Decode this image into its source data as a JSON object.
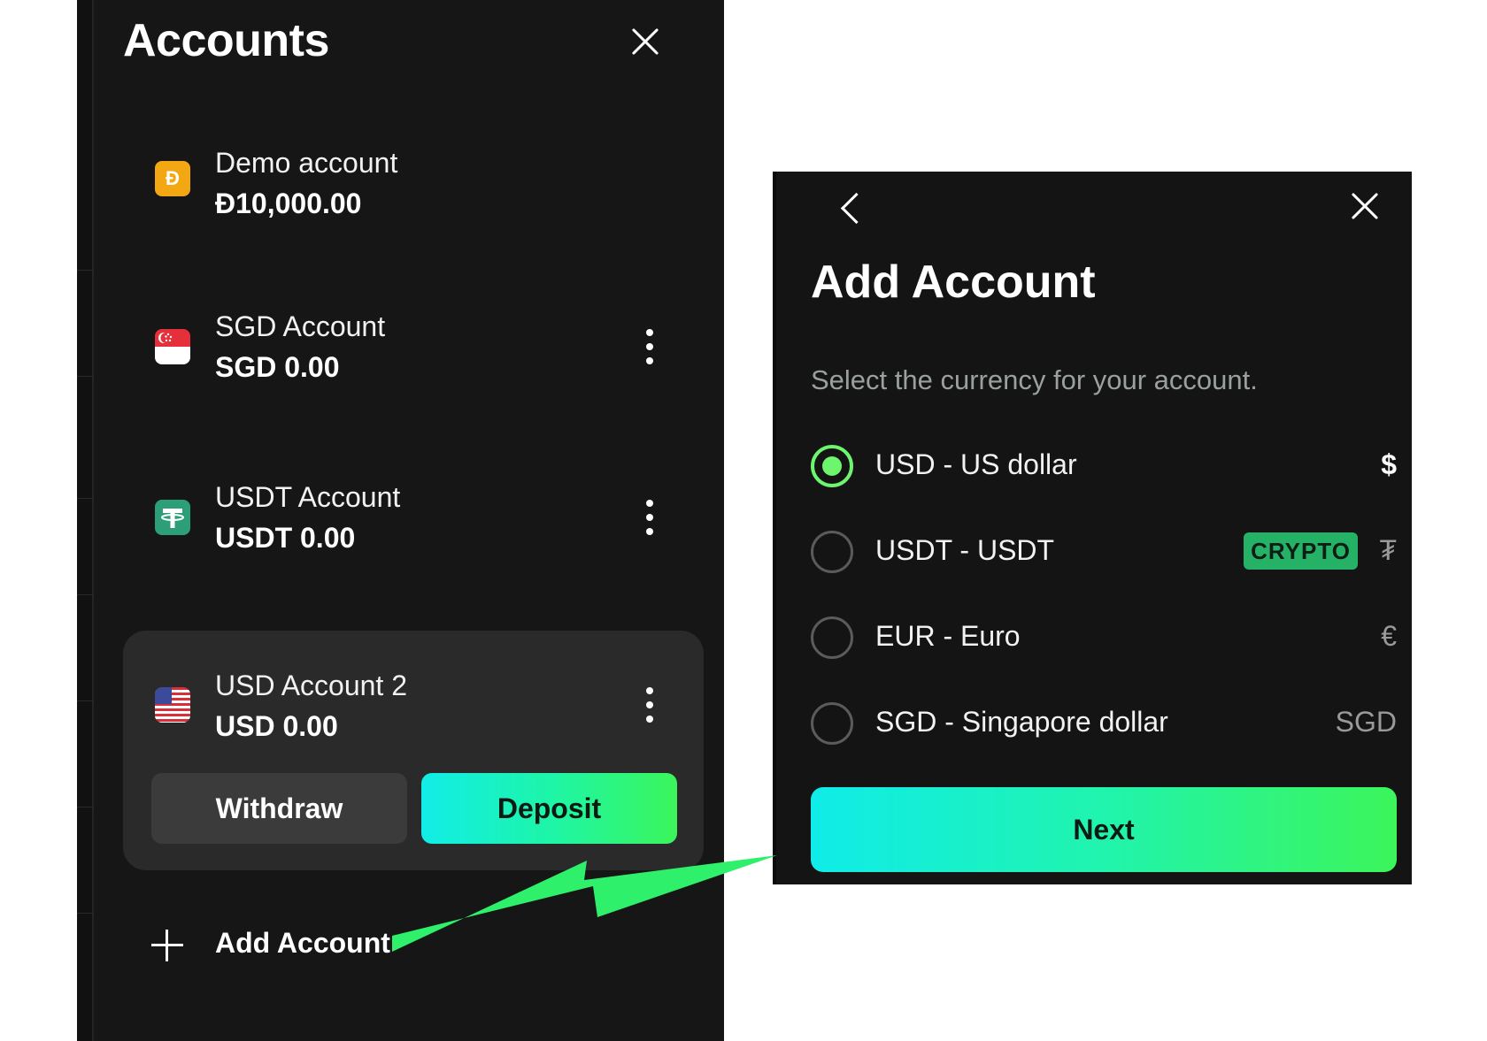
{
  "accounts_panel": {
    "title": "Accounts",
    "accounts": [
      {
        "name": "Demo account",
        "balance": "Đ10,000.00",
        "icon": "demo-coin-icon",
        "icon_glyph": "Đ"
      },
      {
        "name": "SGD Account",
        "balance": "SGD 0.00",
        "icon": "singapore-flag-icon"
      },
      {
        "name": "USDT Account",
        "balance": "USDT 0.00",
        "icon": "tether-icon",
        "icon_glyph": "₮"
      },
      {
        "name": "USD Account 2",
        "balance": "USD 0.00",
        "icon": "us-flag-icon"
      }
    ],
    "withdraw_label": "Withdraw",
    "deposit_label": "Deposit",
    "add_account_label": "Add Account"
  },
  "add_account_dialog": {
    "title": "Add Account",
    "subtitle": "Select the currency for your account.",
    "currencies": [
      {
        "label": "USD - US dollar",
        "symbol": "$",
        "selected": true
      },
      {
        "label": "USDT - USDT",
        "symbol": "₮",
        "badge": "CRYPTO",
        "selected": false
      },
      {
        "label": "EUR - Euro",
        "symbol": "€",
        "selected": false
      },
      {
        "label": "SGD - Singapore dollar",
        "symbol": "SGD",
        "selected": false
      }
    ],
    "next_label": "Next"
  },
  "colors": {
    "panel_bg": "#161616",
    "card_bg": "#2a2a2a",
    "accent_green": "#6df56e",
    "gradient_start": "#12ede8",
    "gradient_end": "#3bf55a",
    "annotation_arrow": "#2ef06a"
  }
}
